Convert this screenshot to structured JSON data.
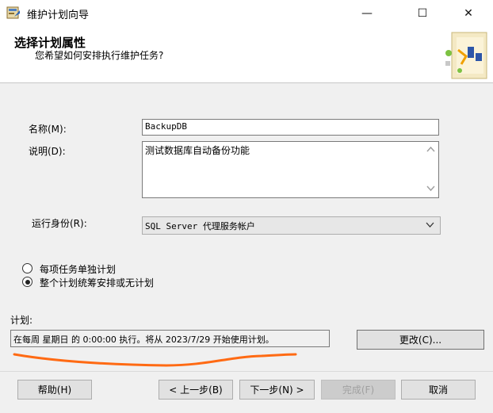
{
  "window": {
    "title": "维护计划向导",
    "minimize": "—",
    "maximize": "☐",
    "close": "✕"
  },
  "header": {
    "heading": "选择计划属性",
    "subheading": "您希望如何安排执行维护任务?"
  },
  "form": {
    "name_label": "名称(M):",
    "name_value": "BackupDB",
    "description_label": "说明(D):",
    "description_value": "测试数据库自动备份功能",
    "runas_label": "运行身份(R):",
    "runas_value": "SQL Server 代理服务帐户"
  },
  "options": {
    "separate_label": "每项任务单独计划",
    "single_label": "整个计划统筹安排或无计划",
    "selected": "single"
  },
  "schedule": {
    "label": "计划:",
    "value": "在每周 星期日 的 0:00:00 执行。将从 2023/7/29 开始使用计划。",
    "change_button": "更改(C)..."
  },
  "footer": {
    "help": "帮助(H)",
    "prev": "< 上一步(B)",
    "next": "下一步(N) >",
    "finish": "完成(F)",
    "cancel": "取消"
  },
  "colors": {
    "annotation": "#ff6a13",
    "button_face": "#e1e1e1",
    "panel": "#f0f0f0"
  }
}
